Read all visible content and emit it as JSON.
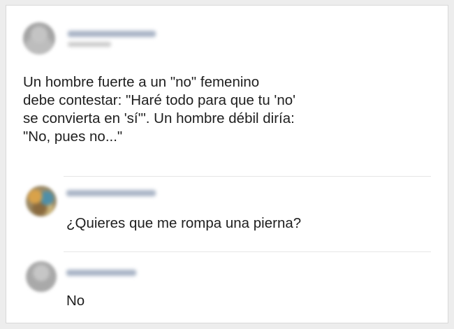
{
  "post": {
    "lines": [
      "Un hombre fuerte a un \"no\" femenino",
      "debe contestar: \"Haré todo para que tu 'no'",
      "se convierta en 'sí'\". Un hombre débil diría:",
      "\"No, pues no...\""
    ]
  },
  "comments": [
    {
      "text": "¿Quieres que me rompa una pierna?"
    },
    {
      "text": "No"
    }
  ],
  "colors": {
    "background": "#ededed",
    "card": "#ffffff",
    "text": "#1e1e1e",
    "blurred_name": "#a9b4c6"
  }
}
